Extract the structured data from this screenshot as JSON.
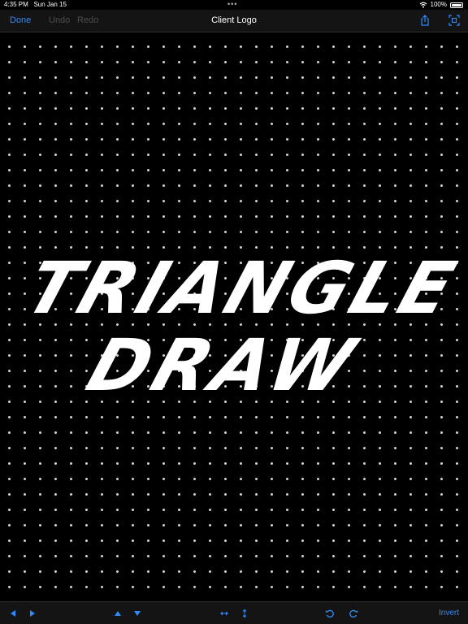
{
  "status": {
    "time": "4:35 PM",
    "date": "Sun Jan 15",
    "battery": "100%",
    "dots": "•••"
  },
  "nav": {
    "done": "Done",
    "undo": "Undo",
    "redo": "Redo",
    "title": "Client Logo"
  },
  "toolbar": {
    "invert": "Invert"
  },
  "logo": {
    "line1": "TRIANGLE",
    "line2": "DRAW"
  },
  "colors": {
    "accent": "#2e8bff",
    "disabled": "#4d4d4d",
    "bar": "#141414",
    "dot": "#cfcfcf"
  },
  "icons": [
    "share-icon",
    "fullscreen-capture-icon",
    "triangle-left-icon",
    "triangle-right-icon",
    "triangle-up-icon",
    "triangle-down-icon",
    "flip-horizontal-icon",
    "flip-vertical-icon",
    "rotate-ccw-icon",
    "rotate-cw-icon",
    "wifi-icon",
    "battery-icon"
  ]
}
